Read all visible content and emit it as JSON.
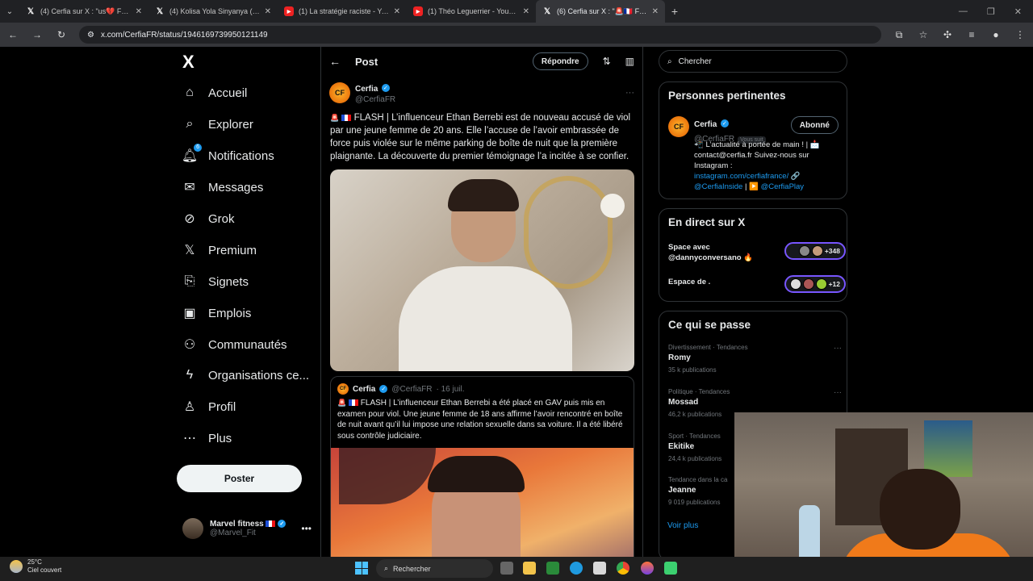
{
  "browser": {
    "tabs": [
      {
        "title": "(4) Cerfia sur X : \"us💔 FLASH |",
        "icon": "x-icon"
      },
      {
        "title": "(4) Kolisa Yola Sinyanya (PhD) 🇿🇦",
        "icon": "x-icon"
      },
      {
        "title": "(1) La stratégie raciste - YouTub",
        "icon": "youtube-icon"
      },
      {
        "title": "(1) Théo Leguerrier - YouTube",
        "icon": "youtube-icon"
      },
      {
        "title": "(6) Cerfia sur X : \"🚨🇫🇷 FLASH |",
        "icon": "x-icon"
      }
    ],
    "url": "x.com/CerfiaFR/status/1946169739950121149"
  },
  "nav": {
    "logo": "X",
    "items": [
      {
        "label": "Accueil",
        "icon": "home-icon"
      },
      {
        "label": "Explorer",
        "icon": "search-icon"
      },
      {
        "label": "Notifications",
        "icon": "bell-icon",
        "badge": "6"
      },
      {
        "label": "Messages",
        "icon": "envelope-icon"
      },
      {
        "label": "Grok",
        "icon": "grok-icon"
      },
      {
        "label": "Premium",
        "icon": "x-icon"
      },
      {
        "label": "Signets",
        "icon": "bookmark-icon"
      },
      {
        "label": "Emplois",
        "icon": "briefcase-icon"
      },
      {
        "label": "Communautés",
        "icon": "people-icon"
      },
      {
        "label": "Organisations ce...",
        "icon": "lightning-icon"
      },
      {
        "label": "Profil",
        "icon": "person-icon"
      },
      {
        "label": "Plus",
        "icon": "more-circle-icon"
      }
    ],
    "post_button": "Poster",
    "account": {
      "name": "Marvel fitness",
      "handle": "@Marvel_Fit"
    }
  },
  "main": {
    "title": "Post",
    "reply_button": "Répondre",
    "tweet": {
      "author_name": "Cerfia",
      "author_handle": "@CerfiaFR",
      "text": "FLASH | L’influenceur Ethan Berrebi est de nouveau accusé de viol par une jeune femme de 20 ans. Elle l’accuse de l’avoir embrassée de force puis violée sur le même parking de boîte de nuit que la première plaignante. La découverte du premier témoignage l’a incitée à se confier."
    },
    "quote": {
      "author_name": "Cerfia",
      "author_handle": "@CerfiaFR",
      "date": "· 16 juil.",
      "text": "FLASH | L’influenceur Ethan Berrebi a été placé en GAV puis mis en examen pour viol. Une jeune femme de 18 ans affirme l’avoir rencontré en boîte de nuit avant qu’il lui impose une relation sexuelle dans sa voiture. Il a été libéré sous contrôle judiciaire."
    }
  },
  "right": {
    "search_placeholder": "Chercher",
    "relevant": {
      "title": "Personnes pertinentes",
      "name": "Cerfia",
      "handle": "@CerfiaFR",
      "follows_you": "Vous suit",
      "follow_button": "Abonné",
      "bio_line1": "L’actualité à portée de main ! |",
      "bio_line2": "contact@cerfia.fr Suivez-nous sur Instagram :",
      "bio_link1": "instagram.com/cerfiafrance/",
      "bio_link2": "@CerfiaInside",
      "bio_link3": "@CerfiaPlay"
    },
    "live": {
      "title": "En direct sur X",
      "spaces": [
        {
          "label": "Space avec @dannyconversano 🔥",
          "count": "+348"
        },
        {
          "label": "Espace de .",
          "count": "+12"
        }
      ]
    },
    "trends": {
      "title": "Ce qui se passe",
      "items": [
        {
          "category": "Divertissement · Tendances",
          "name": "Romy",
          "count": "35 k publications"
        },
        {
          "category": "Politique · Tendances",
          "name": "Mossad",
          "count": "46,2 k publications"
        },
        {
          "category": "Sport · Tendances",
          "name": "Ekitike",
          "count": "24,4 k publications"
        },
        {
          "category": "Tendance dans la ca",
          "name": "Jeanne",
          "count": "9 019 publications"
        }
      ],
      "see_more": "Voir plus"
    }
  },
  "taskbar": {
    "temperature": "25°C",
    "weather": "Ciel couvert",
    "search": "Rechercher"
  },
  "colors": {
    "accent": "#1d9bf0",
    "background": "#000000",
    "live_border": "#7856ff"
  }
}
